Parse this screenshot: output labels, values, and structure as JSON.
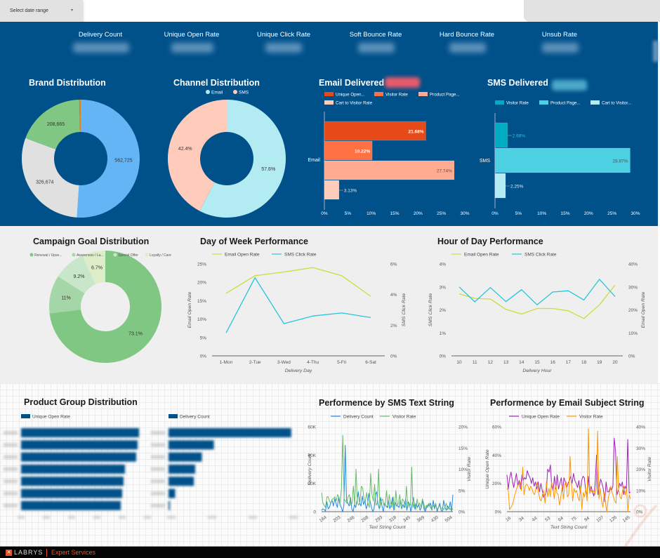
{
  "header": {
    "date_range_label": "Select date range",
    "date_range_caret": "▾"
  },
  "kpis": [
    {
      "label": "Delivery Count"
    },
    {
      "label": "Unique Open Rate"
    },
    {
      "label": "Unique Click Rate"
    },
    {
      "label": "Soft Bounce Rate"
    },
    {
      "label": "Hard Bounce Rate"
    },
    {
      "label": "Unsub Rate"
    }
  ],
  "colors": {
    "header_blue": "#00508a",
    "brand_blue": "#64b5f6",
    "brand_gray": "#e0e0e0",
    "brand_green": "#81c784",
    "brand_orange": "#e67e22",
    "email_cyan": "#b2ebf2",
    "sms_peach": "#ffccbc",
    "email_bar1": "#e64a19",
    "email_bar2": "#ff7043",
    "email_bar3": "#ffab91",
    "email_bar4": "#ffccbc",
    "sms_bar1": "#00acc1",
    "sms_bar2": "#4dd0e1",
    "sms_bar3": "#b2ebf2",
    "line_yellow": "#cddc39",
    "line_cyan": "#26c6da",
    "line_blue": "#1e88e5",
    "line_green": "#66bb6a",
    "line_purple": "#9c27b0",
    "line_orange": "#ff9800",
    "footer_accent": "#e0562a"
  },
  "chart_data": [
    {
      "id": "brand",
      "type": "pie",
      "title": "Brand Distribution",
      "slices": [
        {
          "label": "",
          "value": 562725,
          "display": "562,725",
          "color": "#64b5f6"
        },
        {
          "label": "",
          "value": 326674,
          "display": "326,674",
          "color": "#e0e0e0"
        },
        {
          "label": "",
          "value": 208665,
          "display": "208,665",
          "color": "#81c784"
        },
        {
          "label": "",
          "value": 4500,
          "display": "",
          "color": "#e67e22"
        }
      ]
    },
    {
      "id": "channel",
      "type": "pie",
      "title": "Channel Distribution",
      "legend": [
        "Email",
        "SMS"
      ],
      "slices": [
        {
          "label": "Email",
          "value": 57.6,
          "display": "57.6%",
          "color": "#b2ebf2"
        },
        {
          "label": "SMS",
          "value": 42.4,
          "display": "42.4%",
          "color": "#ffccbc"
        }
      ]
    },
    {
      "id": "email_delivered",
      "type": "bar",
      "title": "Email Delivered",
      "categories": [
        "Email"
      ],
      "series": [
        {
          "name": "Unique Open...",
          "values": [
            21.68
          ],
          "display": "21.68%",
          "color": "#e64a19"
        },
        {
          "name": "Visitor Rate",
          "values": [
            10.22
          ],
          "display": "10.22%",
          "color": "#ff7043"
        },
        {
          "name": "Product Page...",
          "values": [
            27.74
          ],
          "display": "27.74%",
          "color": "#ffab91"
        },
        {
          "name": "Cart to Visitor Rate",
          "values": [
            3.13
          ],
          "display": "3.13%",
          "color": "#ffccbc"
        }
      ],
      "xlim": [
        0,
        30
      ],
      "xticks": [
        "0%",
        "5%",
        "10%",
        "15%",
        "20%",
        "25%",
        "30%"
      ]
    },
    {
      "id": "sms_delivered",
      "type": "bar",
      "title": "SMS Delivered",
      "categories": [
        "SMS"
      ],
      "series": [
        {
          "name": "Visitor Rate",
          "values": [
            2.66
          ],
          "display": "2.66%",
          "color": "#00acc1"
        },
        {
          "name": "Product Page...",
          "values": [
            28.87
          ],
          "display": "28.87%",
          "color": "#4dd0e1"
        },
        {
          "name": "Cart to Visitor...",
          "values": [
            2.25
          ],
          "display": "2.25%",
          "color": "#b2ebf2"
        }
      ],
      "xlim": [
        0,
        30
      ],
      "xticks": [
        "0%",
        "5%",
        "10%",
        "15%",
        "20%",
        "25%",
        "30%"
      ]
    },
    {
      "id": "campaign_goal",
      "type": "pie",
      "title": "Campaign Goal Distribution",
      "legend": [
        "Renewal / Upse...",
        "Awareness / La...",
        "Special Offer",
        "Loyalty / Care"
      ],
      "slices": [
        {
          "label": "Renewal / Upse...",
          "value": 73.1,
          "display": "73.1%",
          "color": "#81c784"
        },
        {
          "label": "Awareness / La...",
          "value": 11,
          "display": "11%",
          "color": "#a5d6a7"
        },
        {
          "label": "Special Offer",
          "value": 9.2,
          "display": "9.2%",
          "color": "#c8e6c9"
        },
        {
          "label": "Loyalty / Care",
          "value": 6.7,
          "display": "6.7%",
          "color": "#dcedc8"
        }
      ]
    },
    {
      "id": "day_of_week",
      "type": "line",
      "title": "Day of Week Performance",
      "categories": [
        "1-Mon",
        "2-Tue",
        "3-Wed",
        "4-Thu",
        "5-Fri",
        "6-Sat"
      ],
      "xlabel": "Delivery Day",
      "ylabel_left": "Email Open Rate",
      "ylabel_right": "SMS Click Rate",
      "ylim_left": [
        0,
        25
      ],
      "ylim_right": [
        0,
        6
      ],
      "yticks_left": [
        "0%",
        "5%",
        "10%",
        "15%",
        "20%",
        "25%"
      ],
      "yticks_right": [
        "0%",
        "2%",
        "4%",
        "6%"
      ],
      "series": [
        {
          "name": "Email Open Rate",
          "axis": "left",
          "values": [
            17,
            21.8,
            22.8,
            24,
            21.8,
            16.2
          ],
          "color": "#cddc39"
        },
        {
          "name": "SMS Click Rate",
          "axis": "right",
          "values": [
            1.5,
            5.1,
            2.1,
            2.6,
            2.8,
            2.5
          ],
          "color": "#26c6da"
        }
      ]
    },
    {
      "id": "hour_of_day",
      "type": "line",
      "title": "Hour of Day Performance",
      "categories": [
        "10",
        "11",
        "12",
        "13",
        "14",
        "15",
        "16",
        "17",
        "18",
        "19",
        "20"
      ],
      "xlabel": "Delivery Hour",
      "ylabel_left": "SMS Click Rate",
      "ylabel_right": "Email Open Rate",
      "ylim_left": [
        0,
        4
      ],
      "ylim_right": [
        0,
        40
      ],
      "yticks_left": [
        "0%",
        "1%",
        "2%",
        "3%",
        "4%"
      ],
      "yticks_right": [
        "0%",
        "10%",
        "20%",
        "30%",
        "40%"
      ],
      "series": [
        {
          "name": "Email Open Rate",
          "axis": "right",
          "values": [
            27,
            25,
            24.7,
            20.2,
            18.2,
            20.6,
            20.6,
            19.6,
            16.2,
            22.2,
            30.8
          ],
          "color": "#cddc39"
        },
        {
          "name": "SMS Click Rate",
          "axis": "left",
          "values": [
            3.0,
            2.35,
            2.97,
            2.36,
            2.88,
            2.22,
            2.78,
            2.83,
            2.43,
            3.33,
            2.58
          ],
          "color": "#26c6da"
        }
      ]
    },
    {
      "id": "product_group_open",
      "type": "bar",
      "title": "Product Group Distribution",
      "legend": [
        "Unique Open Rate"
      ],
      "note": "labels and values are blurred in the screenshot",
      "values_fraction_of_axis": [
        0.84,
        0.83,
        0.82,
        0.74,
        0.73,
        0.72,
        0.71
      ],
      "color": "#00508a"
    },
    {
      "id": "product_group_delivery",
      "type": "bar",
      "legend": [
        "Delivery Count"
      ],
      "note": "labels and values are blurred in the screenshot",
      "values_fraction_of_axis": [
        0.92,
        0.34,
        0.25,
        0.2,
        0.19,
        0.05,
        0.01
      ],
      "color": "#00508a"
    },
    {
      "id": "sms_text_string",
      "type": "line",
      "title": "Performence by SMS Text String",
      "xlabel": "Text String Count",
      "ylabel_left": "Delivery Count",
      "ylabel_right": "Visitor Rate",
      "xticks": [
        "164",
        "203",
        "246",
        "268",
        "293",
        "318",
        "345",
        "369",
        "430",
        "504"
      ],
      "yticks_left": [
        "0",
        "20K",
        "40K",
        "60K"
      ],
      "yticks_right": [
        "0%",
        "5%",
        "10%",
        "15%",
        "20%"
      ],
      "ylim_left": [
        0,
        60000
      ],
      "ylim_right": [
        0,
        20
      ],
      "series": [
        {
          "name": "Delivery Count",
          "axis": "left",
          "color": "#1e88e5",
          "values": [
            1000,
            2000,
            1500,
            500,
            7000,
            2000,
            3000,
            6000,
            8000,
            4000,
            9000,
            6000,
            3000,
            10000,
            5000,
            3000,
            0,
            4000,
            47000,
            8000,
            6000,
            4000,
            10000,
            2000,
            0,
            5000,
            3000,
            8000,
            14000,
            6000,
            4000,
            11000,
            5000,
            8000,
            2000,
            5000,
            13000,
            7000,
            3000,
            0,
            2000,
            12000,
            14000,
            5000,
            2000,
            10000,
            4000,
            0,
            6000,
            4000,
            3000,
            8000,
            2000,
            5000,
            10000,
            1000,
            7000,
            4000,
            4000,
            3000,
            8000,
            2000,
            5000,
            3000,
            9000,
            1000,
            7000,
            5000,
            0,
            5000,
            10000,
            2000,
            6000,
            3000,
            5000,
            1000,
            3000,
            8000,
            2000,
            0,
            3000,
            5000,
            4000,
            6000,
            1000,
            8000,
            2000,
            5000,
            0,
            3000,
            6000,
            1000,
            0,
            8000,
            3000,
            1000,
            4000,
            2000,
            7000,
            0,
            12000
          ]
        },
        {
          "name": "Visitor Rate",
          "axis": "right",
          "color": "#66bb6a",
          "values": [
            4.5,
            2,
            1.5,
            1,
            3.5,
            3.5,
            2.5,
            2,
            3,
            3,
            3.5,
            2.5,
            4,
            3.5,
            2,
            5.5,
            18,
            3,
            2.5,
            2,
            3.5,
            4,
            1.5,
            2,
            6,
            1.5,
            10,
            2,
            1.5,
            2.5,
            6,
            5.5,
            3,
            2.5,
            4.5,
            2,
            1,
            9,
            4,
            2.5,
            6.5,
            1.5,
            2,
            10,
            1,
            2.5,
            3,
            1.5,
            2,
            5,
            1,
            4,
            2,
            1,
            3.5,
            0.5,
            5,
            1.5,
            2,
            4,
            1,
            3,
            2.5,
            1,
            6,
            1,
            2,
            1.5,
            10.5,
            1,
            2,
            0.5,
            3,
            1.5,
            2,
            1,
            3,
            2,
            0.5,
            1.5,
            1,
            2,
            1,
            0.5,
            1.5,
            1,
            2,
            0.5,
            1,
            1.5,
            0.5,
            1,
            0.5,
            1,
            2,
            0.5,
            1,
            0.5,
            1,
            0.5
          ]
        }
      ]
    },
    {
      "id": "email_subject_string",
      "type": "line",
      "title": "Performence by Email Subject String",
      "xlabel": "Text String Count",
      "ylabel_left": "Unique Open Rate",
      "ylabel_right": "Visitor Rate",
      "xticks": [
        "16",
        "34",
        "44",
        "53",
        "64",
        "75",
        "94",
        "107",
        "126",
        "145"
      ],
      "yticks_left": [
        "0%",
        "20%",
        "40%",
        "60%"
      ],
      "yticks_right": [
        "0%",
        "10%",
        "20%",
        "30%",
        "40%"
      ],
      "ylim_left": [
        0,
        60
      ],
      "ylim_right": [
        0,
        40
      ],
      "series": [
        {
          "name": "Unique Open Rate",
          "axis": "left",
          "color": "#9c27b0",
          "values": [
            26,
            16,
            24,
            28,
            22,
            17,
            22,
            27,
            18,
            22,
            16,
            26,
            22,
            24,
            23,
            29,
            26,
            24,
            20,
            24,
            18,
            21,
            16,
            21,
            14,
            20,
            15,
            10,
            12,
            14,
            30,
            28,
            33,
            18,
            15,
            25,
            16,
            26,
            16,
            20,
            24,
            14,
            24,
            21,
            17,
            20,
            22,
            25,
            20,
            27,
            22,
            20,
            17,
            22,
            13,
            22,
            25,
            24,
            15,
            12,
            25,
            13,
            18,
            14,
            11,
            20,
            40,
            12,
            18,
            23,
            20,
            16,
            7,
            21,
            14,
            14,
            17,
            15,
            18,
            52,
            43,
            12,
            15,
            20,
            18,
            21,
            12,
            18,
            16,
            51,
            13,
            14
          ]
        },
        {
          "name": "Visitor Rate",
          "axis": "right",
          "color": "#ff9800",
          "values": [
            11,
            10,
            1,
            2,
            3,
            5,
            8,
            10,
            12,
            13,
            14,
            10,
            21,
            8,
            12,
            13,
            12,
            10,
            12,
            11,
            9,
            8,
            11,
            14,
            9,
            6,
            5,
            8,
            10,
            4,
            14,
            7,
            11,
            7,
            14,
            11,
            6,
            13,
            9,
            8,
            3,
            7,
            12,
            6,
            13,
            14,
            7,
            8,
            26,
            14,
            5,
            11,
            9,
            10,
            7,
            5,
            12,
            1,
            9,
            7,
            11,
            5,
            39,
            9,
            10,
            9,
            10,
            8,
            11,
            38,
            6,
            11,
            5,
            2,
            9,
            4,
            0,
            6,
            9,
            12,
            9,
            7,
            5,
            4,
            26,
            10,
            7,
            6,
            10,
            12,
            8,
            11,
            0,
            8,
            6
          ]
        }
      ]
    }
  ],
  "footer": {
    "logo_mark": "✕",
    "brand": "LABRYS",
    "tagline": "Expert Services"
  }
}
